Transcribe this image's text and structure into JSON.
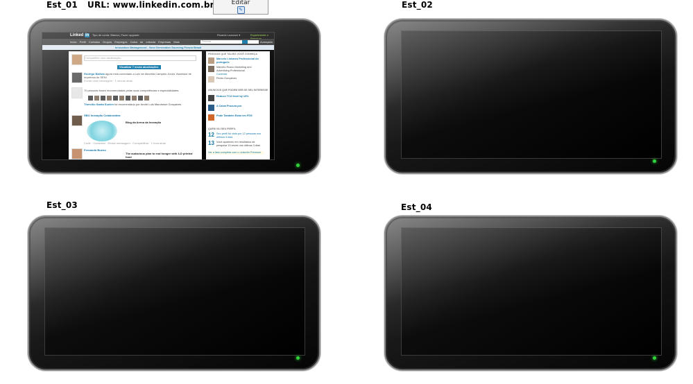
{
  "labels": {
    "est_01": "Est_01",
    "url": "URL: www.linkedin.com.br",
    "est_02": "Est_02",
    "est_03": "Est_03",
    "est_04": "Est_04"
  },
  "edit_box": {
    "label": "Editar"
  },
  "linkedin_screen": {
    "logo_text": "Linked",
    "logo_in": "in",
    "top_text": "Tipo de conta: Básica | Fazer upgrade",
    "user_text": "Ricardo Lazaroni ▾",
    "premium_text": "Experimente o Premium",
    "nav_items": "Início  Perfil  Contatos  Grupos  Empregos  Caixa de entrada  Empresas  Mais",
    "search_placeholder": "Pessoas",
    "advanced": "Avançada",
    "banner": "Innovation Management - Next Generation Sourcing Forum Brasil",
    "feed": {
      "share_placeholder": "Compartilhe uma atualização...",
      "view_updates": "Visualizar 7 novas atualizações",
      "post1_who": "Rodrigo Batista",
      "post1_text": "agora está conectado a Luiz de Almeida Campelo Júnior, Assessor de Imprensa do SENI",
      "post1_meta": "Enviar uma mensagem · 1 minuto atrás",
      "post2_text": "70 pessoas foram recomendadas pelas suas competências e especialidades.",
      "post2_who": "Thercilio Santa Suelen",
      "post2_text2": "foi recomendado por André Luis Marchesin Gonçalves",
      "post3_who": "SBO Inovação Colaborativa",
      "post3_title": "Blog da Arena da Inovação",
      "post3_meta": "Curtir · Comentar · Enviar mensagem · Compartilhar · 1 hora atrás",
      "post4_who": "Fernando Bueno",
      "post4_title": "The audacious plan to end hunger with 3-D printed food"
    },
    "side": {
      "head1": "PESSOAS QUE TALVEZ VOCÊ CONHEÇA",
      "person1": "Marcelo Linhares Professional do português",
      "person2": "Marcelo Russo Marketing and Advertising Professional",
      "person3": "Pedro Gonçalves",
      "connect": "Conectar",
      "head2": "ANÚNCIOS QUE PODEM SER DE SEU INTERESSE",
      "ad1": "Reduce TCO level by 10%",
      "ad2": "A Caixa Procura por",
      "ad3": "Pode Também Estar em FGS",
      "head3": "QUEM VIU SEU PERFIL",
      "views1_num": "12",
      "views1_text": "Seu perfil foi visto por 12 pessoas nos últimos 3 dias",
      "views2_num": "13",
      "views2_text": "Você apareceu em resultados de pesquisa 13 vezes nos últimos 3 dias",
      "premium": "Ver a lista completa com o LinkedIn Premium"
    }
  }
}
